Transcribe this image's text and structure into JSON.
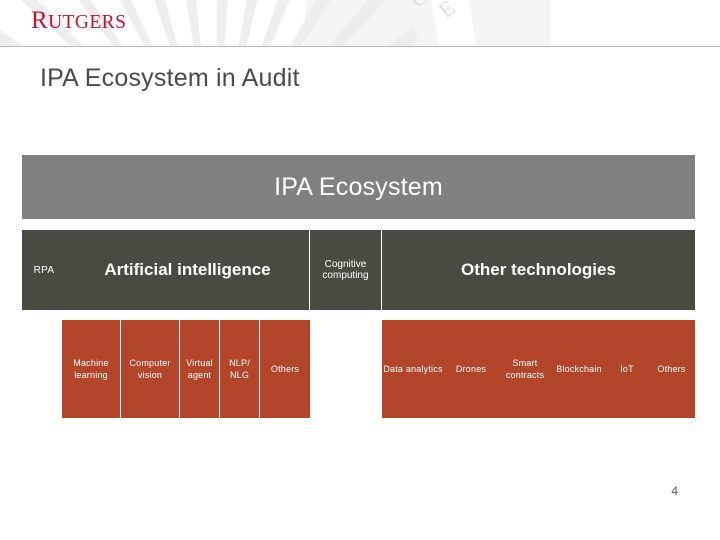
{
  "header": {
    "logo_text": "RUTGERS",
    "logo_color": "#c41230",
    "watermark_name": "rutgers-shield-sunburst-watermark"
  },
  "slide": {
    "title": "IPA Ecosystem in Audit",
    "page_number": "4"
  },
  "diagram": {
    "band_title": "IPA Ecosystem",
    "band_color": "#808080",
    "category_color": "#4a4a42",
    "leaf_color": "#b3462a",
    "categories": [
      {
        "label": "RPA"
      },
      {
        "label": "Artificial intelligence"
      },
      {
        "label": "Cognitive computing"
      },
      {
        "label": "Other technologies"
      }
    ],
    "ai_leaves": [
      {
        "label": "Machine learning"
      },
      {
        "label": "Computer vision"
      },
      {
        "label": "Virtual agent"
      },
      {
        "label": "NLP/ NLG"
      },
      {
        "label": "Others"
      }
    ],
    "other_leaves": [
      {
        "label": "Data analytics"
      },
      {
        "label": "Drones"
      },
      {
        "label": "Smart contracts"
      },
      {
        "label": "Blockchain"
      },
      {
        "label": "IoT"
      },
      {
        "label": "Others"
      }
    ]
  }
}
